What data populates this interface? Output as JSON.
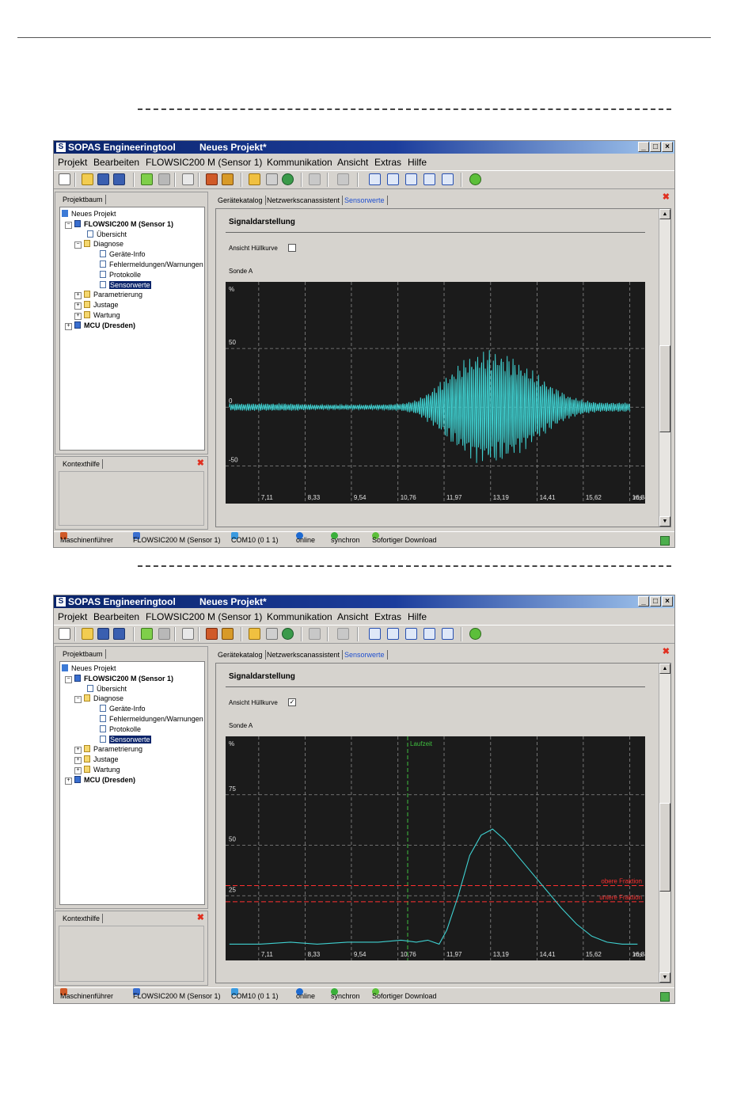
{
  "windows": [
    {
      "title_app": "SOPAS Engineeringtool",
      "title_project": "Neues Projekt*",
      "menu": [
        "Projekt",
        "Bearbeiten",
        "FLOWSIC200 M (Sensor 1)",
        "Kommunikation",
        "Ansicht",
        "Extras",
        "Hilfe"
      ],
      "tree_tab": "Projektbaum",
      "tree": [
        "Neues Projekt",
        "FLOWSIC200 M (Sensor 1)",
        "Übersicht",
        "Diagnose",
        "Geräte-Info",
        "Fehlermeldungen/Warnungen",
        "Protokolle",
        "Sensorwerte",
        "Parametrierung",
        "Justage",
        "Wartung",
        "MCU (Dresden)"
      ],
      "help_tab": "Kontexthilfe",
      "tabs": [
        "Gerätekatalog",
        "Netzwerkscanassistent",
        "Sensorwerte"
      ],
      "section_title": "Signaldarstellung",
      "checkbox_label": "Ansicht Hüllkurve",
      "checkbox_checked": false,
      "probe_label": "Sonde A",
      "chart_unit": "%",
      "status": [
        "Maschinenführer",
        "FLOWSIC200 M (Sensor 1)",
        "COM10 (0 1 1)",
        "online",
        "synchron",
        "Sofortiger Download"
      ]
    },
    {
      "title_app": "SOPAS Engineeringtool",
      "title_project": "Neues Projekt*",
      "menu": [
        "Projekt",
        "Bearbeiten",
        "FLOWSIC200 M (Sensor 1)",
        "Kommunikation",
        "Ansicht",
        "Extras",
        "Hilfe"
      ],
      "tree_tab": "Projektbaum",
      "tree": [
        "Neues Projekt",
        "FLOWSIC200 M (Sensor 1)",
        "Übersicht",
        "Diagnose",
        "Geräte-Info",
        "Fehlermeldungen/Warnungen",
        "Protokolle",
        "Sensorwerte",
        "Parametrierung",
        "Justage",
        "Wartung",
        "MCU (Dresden)"
      ],
      "help_tab": "Kontexthilfe",
      "tabs": [
        "Gerätekatalog",
        "Netzwerkscanassistent",
        "Sensorwerte"
      ],
      "section_title": "Signaldarstellung",
      "checkbox_label": "Ansicht Hüllkurve",
      "checkbox_checked": true,
      "probe_label": "Sonde A",
      "chart_unit": "%",
      "status": [
        "Maschinenführer",
        "FLOWSIC200 M (Sensor 1)",
        "COM10 (0 1 1)",
        "online",
        "synchron",
        "Sofortiger Download"
      ]
    }
  ],
  "chart_data": [
    {
      "type": "line",
      "xlabel": "ms",
      "x_ticks": [
        "7,11",
        "8,33",
        "9,54",
        "10,76",
        "11,97",
        "13,19",
        "14,41",
        "15,62",
        "16,84"
      ],
      "y_ticks": [
        "50",
        "0",
        "-50"
      ],
      "ylim": [
        -70,
        100
      ],
      "xlim": [
        6.2,
        17.2
      ],
      "grid": true,
      "series": [
        {
          "color": "#3fd0d0",
          "description_of_shape": "oscillating burst",
          "x": [
            6.3,
            7.1,
            7.9,
            8.6,
            9.4,
            10.2,
            10.8,
            11.2,
            11.6,
            12.0,
            12.4,
            12.8,
            13.2,
            13.6,
            14.0,
            14.4,
            14.8,
            15.2,
            15.6,
            16.0,
            16.4,
            16.8
          ],
          "amplitude": [
            3,
            3,
            3,
            2,
            2,
            2,
            3,
            6,
            15,
            28,
            40,
            48,
            50,
            46,
            38,
            28,
            18,
            10,
            6,
            4,
            4,
            4
          ]
        }
      ]
    },
    {
      "type": "line",
      "xlabel": "ms",
      "x_ticks": [
        "7,11",
        "8,33",
        "9,54",
        "10,76",
        "11,97",
        "13,19",
        "14,41",
        "15,62",
        "16,84"
      ],
      "y_ticks": [
        "75",
        "50",
        "25"
      ],
      "ylim": [
        0,
        100
      ],
      "xlim": [
        6.2,
        17.2
      ],
      "grid": true,
      "annotations": [
        {
          "label": "Laufzeit",
          "x": 11.97,
          "color": "#3fbf3f"
        },
        {
          "label": "obere Fraktion",
          "y": 30,
          "color": "#ff3030"
        },
        {
          "label": "untere Fraktion",
          "y": 22,
          "color": "#ff3030"
        }
      ],
      "series": [
        {
          "color": "#3fd0d0",
          "x": [
            6.3,
            7.1,
            7.9,
            8.6,
            9.4,
            10.2,
            10.8,
            11.2,
            11.5,
            11.8,
            12.0,
            12.3,
            12.6,
            12.9,
            13.2,
            13.5,
            13.8,
            14.2,
            14.6,
            15.0,
            15.4,
            15.8,
            16.2,
            16.6,
            17.0
          ],
          "y": [
            1,
            1,
            2,
            1,
            2,
            2,
            3,
            2,
            3,
            1,
            8,
            25,
            45,
            55,
            58,
            53,
            46,
            37,
            28,
            19,
            11,
            5,
            2,
            1,
            1
          ]
        }
      ]
    }
  ]
}
